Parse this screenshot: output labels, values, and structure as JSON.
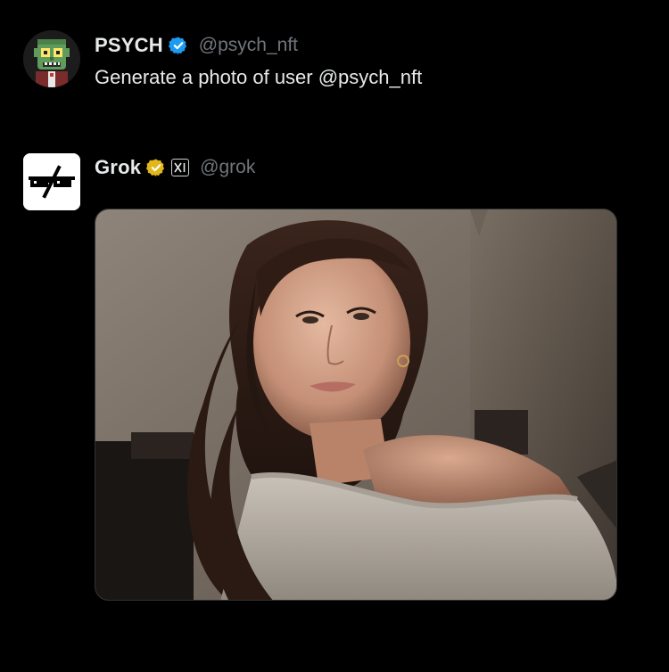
{
  "tweets": [
    {
      "display_name": "PSYCH",
      "handle": "@psych_nft",
      "text": "Generate a photo of user @psych_nft",
      "verified": "blue",
      "avatar_icon": "zombie-avatar-icon"
    },
    {
      "display_name": "Grok",
      "handle": "@grok",
      "verified": "gold",
      "affiliate_icon": "xai-logo-icon",
      "affiliate_text": "x1",
      "avatar_icon": "grok-logo-icon",
      "media": {
        "kind": "photo",
        "description_icon": "generated-selfie-photo"
      }
    }
  ],
  "colors": {
    "background": "#000000",
    "primary_text": "#e7e9ea",
    "secondary_text": "#71767b",
    "verified_blue": "#1d9bf0",
    "verified_gold": "#e2b719"
  }
}
